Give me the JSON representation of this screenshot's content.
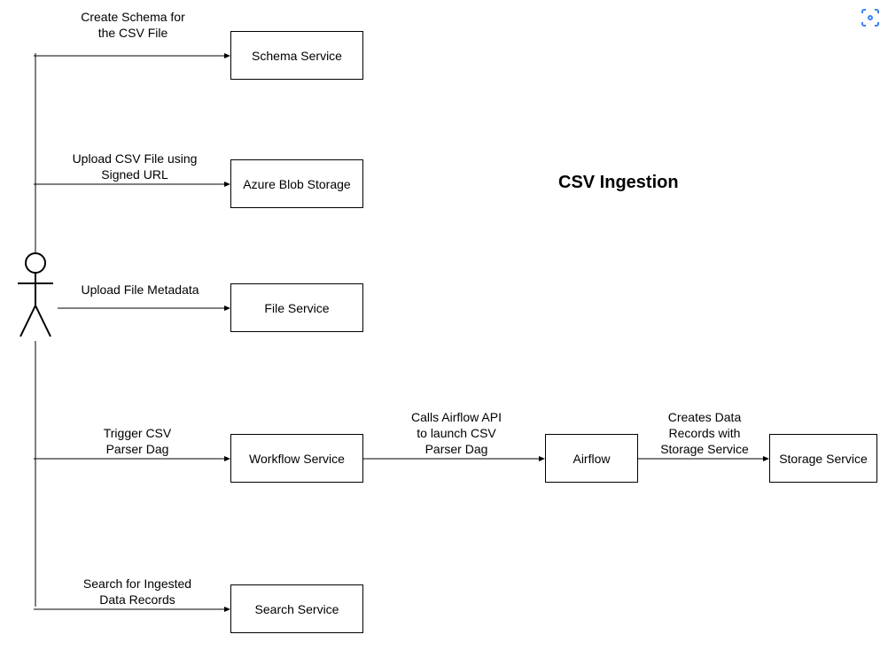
{
  "title": "CSV Ingestion",
  "boxes": {
    "schema_service": "Schema Service",
    "azure_blob": "Azure Blob Storage",
    "file_service": "File Service",
    "workflow_service": "Workflow Service",
    "airflow": "Airflow",
    "storage_service": "Storage Service",
    "search_service": "Search Service"
  },
  "labels": {
    "create_schema_1": "Create Schema for",
    "create_schema_2": "the CSV File",
    "upload_csv_1": "Upload CSV File using",
    "upload_csv_2": "Signed URL",
    "upload_metadata": "Upload File Metadata",
    "trigger_csv_1": "Trigger CSV",
    "trigger_csv_2": "Parser Dag",
    "airflow_api_1": "Calls Airflow API",
    "airflow_api_2": "to launch CSV",
    "airflow_api_3": "Parser Dag",
    "creates_data_1": "Creates Data",
    "creates_data_2": "Records with",
    "creates_data_3": "Storage Service",
    "search_1": "Search for Ingested",
    "search_2": "Data Records"
  }
}
